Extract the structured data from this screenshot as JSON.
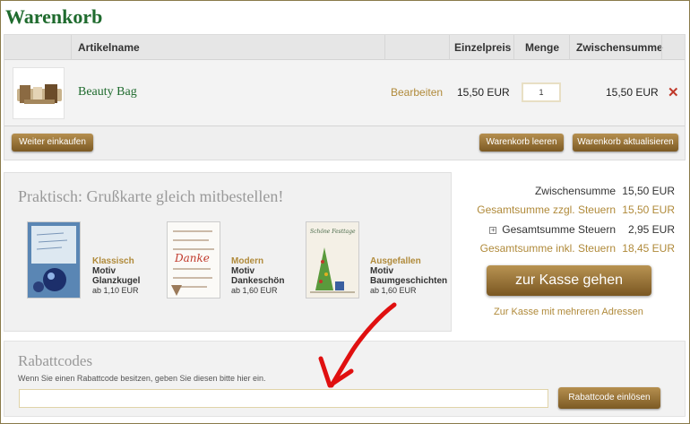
{
  "page": {
    "title": "Warenkorb"
  },
  "cart": {
    "headers": {
      "name": "Artikelname",
      "unit_price": "Einzelpreis",
      "quantity": "Menge",
      "subtotal": "Zwischensumme"
    },
    "item": {
      "name": "Beauty Bag",
      "edit_label": "Bearbeiten",
      "unit_price": "15,50 EUR",
      "quantity": "1",
      "subtotal": "15,50 EUR",
      "remove_icon": "close-x-icon"
    },
    "buttons": {
      "continue": "Weiter einkaufen",
      "empty": "Warenkorb leeren",
      "update": "Warenkorb aktualisieren"
    }
  },
  "promo": {
    "title": "Praktisch: Grußkarte gleich mitbestellen!",
    "cards": [
      {
        "type": "Klassisch",
        "line1": "Motiv",
        "line2": "Glanzkugel",
        "price": "ab 1,10 EUR"
      },
      {
        "type": "Modern",
        "line1": "Motiv",
        "line2": "Dankeschön",
        "price": "ab 1,60 EUR"
      },
      {
        "type": "Ausgefallen",
        "line1": "Motiv",
        "line2": "Baumgeschichten",
        "price": "ab 1,60 EUR"
      }
    ],
    "card_texts": {
      "modern_word": "Danke",
      "fancy_header": "Schöne Festtage"
    }
  },
  "totals": {
    "subtotal_label": "Zwischensumme",
    "subtotal_value": "15,50 EUR",
    "excl_tax_label": "Gesamtsumme zzgl. Steuern",
    "excl_tax_value": "15,50 EUR",
    "tax_label": "Gesamtsumme Steuern",
    "tax_value": "2,95 EUR",
    "incl_tax_label": "Gesamtsumme inkl. Steuern",
    "incl_tax_value": "18,45 EUR",
    "checkout_label": "zur Kasse gehen",
    "multi_address_label": "Zur Kasse mit mehreren Adressen"
  },
  "coupon": {
    "title": "Rabattcodes",
    "description": "Wenn Sie einen Rabattcode besitzen, geben Sie diesen bitte hier ein.",
    "input_value": "",
    "button_label": "Rabattcode einlösen"
  },
  "colors": {
    "brand_green": "#1f6b2e",
    "accent_gold": "#b08a3a",
    "button_gold": "#8a6530",
    "remove_red": "#c0392b",
    "annotation_red": "#e01010"
  }
}
